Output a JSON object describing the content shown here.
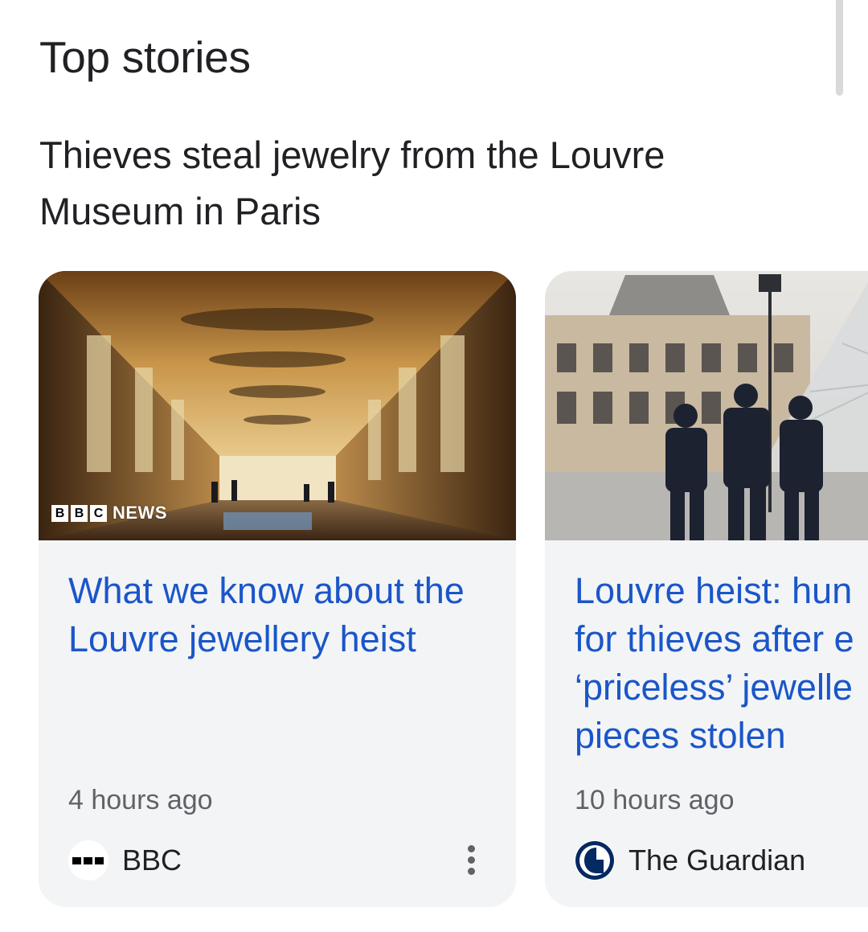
{
  "section": {
    "title": "Top stories"
  },
  "story": {
    "headline": "Thieves steal jewelry from the Louvre Museum in Paris"
  },
  "cards": [
    {
      "title": "What we know about the Louvre jewellery heist",
      "time": "4 hours ago",
      "source": "BBC",
      "image_overlay": {
        "blocks": [
          "B",
          "B",
          "C"
        ],
        "text": "NEWS"
      },
      "icon": "bbc-logo-icon",
      "more_icon": "more-vert-icon"
    },
    {
      "title_lines": [
        "Louvre heist: hun",
        "for thieves after e",
        "‘priceless’ jewelle",
        "pieces stolen"
      ],
      "time": "10 hours ago",
      "source": "The Guardian",
      "icon": "guardian-logo-icon"
    }
  ],
  "colors": {
    "link": "#1a56c9",
    "card_background": "#f3f4f6",
    "text_primary": "#202124",
    "text_secondary": "#5f6368"
  }
}
